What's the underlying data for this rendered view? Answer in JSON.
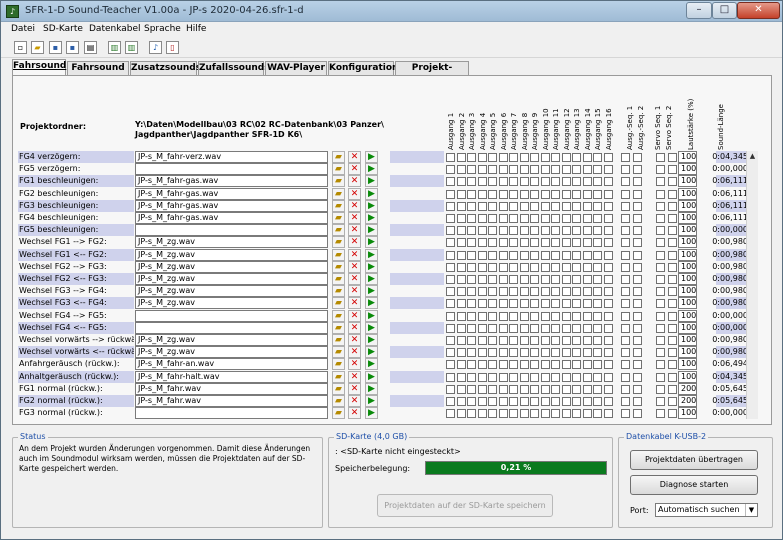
{
  "window": {
    "title": "SFR-1-D Sound-Teacher V1.00a - JP-s 2020-04-26.sfr-1-d",
    "icon": "app-icon"
  },
  "menu": [
    "Datei",
    "SD-Karte",
    "Datenkabel",
    "Sprache",
    "Hilfe"
  ],
  "toolbar": [
    "new-icon",
    "open-icon",
    "save-icon",
    "save-as-icon",
    "print-icon",
    "export-icon",
    "import-icon",
    "music-note-icon",
    "document-icon"
  ],
  "tabs": [
    "Fahrsound",
    "Fahrsound 2",
    "Zusatzsounds",
    "Zufallssounds",
    "WAV-Player",
    "Konfiguration",
    "Projekt-Notizen"
  ],
  "active_tab": 0,
  "projektordner_label": "Projektordner:",
  "projektordner_path": "Y:\\Daten\\Modellbau\\03 RC\\02 RC-Datenbank\\03 Panzer\\ Jagdpanther\\Jagdpanther SFR-1D K6\\",
  "column_headers": [
    "Ausgang 1",
    "Ausgang 2",
    "Ausgang 3",
    "Ausgang 4",
    "Ausgang 5",
    "Ausgang 6",
    "Ausgang 7",
    "Ausgang 8",
    "Ausgang 9",
    "Ausgang 10",
    "Ausgang 11",
    "Ausgang 12",
    "Ausgang 13",
    "Ausgang 14",
    "Ausgang 15",
    "Ausgang 16",
    "Ausg.-Seq. 1",
    "Ausg.-Seq. 2",
    "Servo Seq. 1",
    "Servo Seq. 2",
    "Lautstärke (%)",
    "Sound-Länge"
  ],
  "rows": [
    {
      "label": "FG4 verzögern:",
      "file": "JP-s_M_fahr-verz.wav",
      "vol": "100",
      "len": "0:04,345"
    },
    {
      "label": "FG5 verzögern:",
      "file": "",
      "vol": "100",
      "len": "0:00,000"
    },
    {
      "label": "FG1 beschleunigen:",
      "file": "JP-s_M_fahr-gas.wav",
      "vol": "100",
      "len": "0:06,111"
    },
    {
      "label": "FG2 beschleunigen:",
      "file": "JP-s_M_fahr-gas.wav",
      "vol": "100",
      "len": "0:06,111"
    },
    {
      "label": "FG3 beschleunigen:",
      "file": "JP-s_M_fahr-gas.wav",
      "vol": "100",
      "len": "0:06,111"
    },
    {
      "label": "FG4 beschleunigen:",
      "file": "JP-s_M_fahr-gas.wav",
      "vol": "100",
      "len": "0:06,111"
    },
    {
      "label": "FG5 beschleunigen:",
      "file": "",
      "vol": "100",
      "len": "0:00,000"
    },
    {
      "label": "Wechsel FG1 --> FG2:",
      "file": "JP-s_M_zg.wav",
      "vol": "100",
      "len": "0:00,980"
    },
    {
      "label": "Wechsel FG1 <-- FG2:",
      "file": "JP-s_M_zg.wav",
      "vol": "100",
      "len": "0:00,980"
    },
    {
      "label": "Wechsel FG2 --> FG3:",
      "file": "JP-s_M_zg.wav",
      "vol": "100",
      "len": "0:00,980"
    },
    {
      "label": "Wechsel FG2 <-- FG3:",
      "file": "JP-s_M_zg.wav",
      "vol": "100",
      "len": "0:00,980"
    },
    {
      "label": "Wechsel FG3 --> FG4:",
      "file": "JP-s_M_zg.wav",
      "vol": "100",
      "len": "0:00,980"
    },
    {
      "label": "Wechsel FG3 <-- FG4:",
      "file": "JP-s_M_zg.wav",
      "vol": "100",
      "len": "0:00,980"
    },
    {
      "label": "Wechsel FG4 --> FG5:",
      "file": "",
      "vol": "100",
      "len": "0:00,000"
    },
    {
      "label": "Wechsel FG4 <-- FG5:",
      "file": "",
      "vol": "100",
      "len": "0:00,000"
    },
    {
      "label": "Wechsel vorwärts --> rückwärts",
      "file": "JP-s_M_zg.wav",
      "vol": "100",
      "len": "0:00,980"
    },
    {
      "label": "Wechsel vorwärts <-- rückwärts",
      "file": "JP-s_M_zg.wav",
      "vol": "100",
      "len": "0:00,980"
    },
    {
      "label": "Anfahrgeräusch (rückw.):",
      "file": "JP-s_M_fahr-an.wav",
      "vol": "100",
      "len": "0:06,494"
    },
    {
      "label": "Anhaltgeräusch (rückw.):",
      "file": "JP-s_M_fahr-halt.wav",
      "vol": "100",
      "len": "0:04,345"
    },
    {
      "label": "FG1 normal (rückw.):",
      "file": "JP-s_M_fahr.wav",
      "vol": "200",
      "len": "0:05,645"
    },
    {
      "label": "FG2 normal (rückw.):",
      "file": "JP-s_M_fahr.wav",
      "vol": "200",
      "len": "0:05,645"
    },
    {
      "label": "FG3 normal (rückw.):",
      "file": "",
      "vol": "100",
      "len": "0:00,000"
    }
  ],
  "status": {
    "title": "Status",
    "text": "An dem Projekt wurden Änderungen vorgenommen. Damit diese Änderungen auch im Soundmodul wirksam werden, müssen die Projektdaten auf der SD-Karte gespeichert werden."
  },
  "sd": {
    "title": "SD-Karte (4,0 GB)",
    "status": ": <SD-Karte nicht eingesteckt>",
    "belegung_label": "Speicherbelegung:",
    "belegung_value": "0,21 %",
    "belegung_fraction": 0.0021,
    "save_button": "Projektdaten auf der SD-Karte speichern"
  },
  "kabel": {
    "title": "Datenkabel K-USB-2",
    "transfer_button": "Projektdaten übertragen",
    "diag_button": "Diagnose starten",
    "port_label": "Port:",
    "port_value": "Automatisch suchen"
  }
}
